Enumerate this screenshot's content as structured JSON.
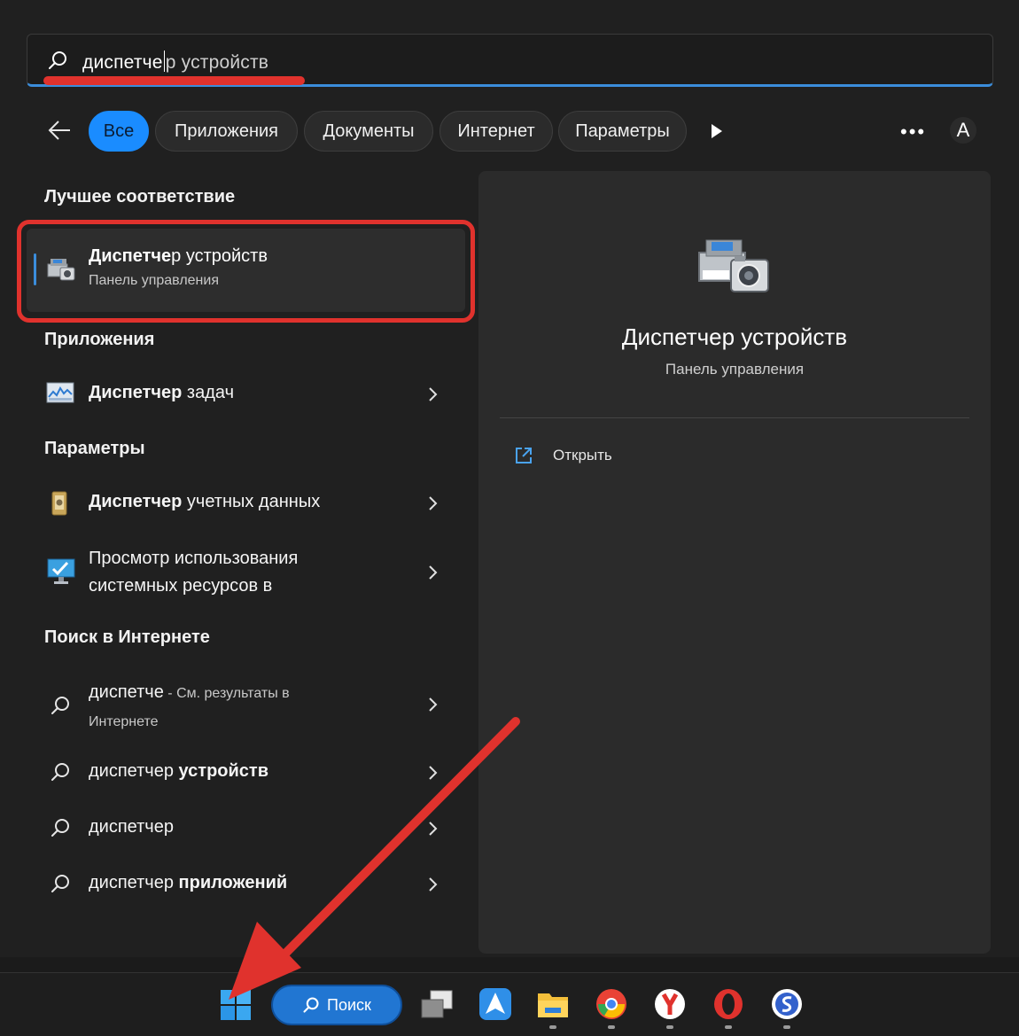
{
  "search": {
    "query_typed": "диспетче",
    "query_suggested": "р устройств"
  },
  "filters": {
    "items": [
      "Все",
      "Приложения",
      "Документы",
      "Интернет",
      "Параметры"
    ],
    "active_index": 0,
    "avatar_letter": "A",
    "more_label": "•••"
  },
  "sections": {
    "best_match": "Лучшее соответствие",
    "apps": "Приложения",
    "settings": "Параметры",
    "web": "Поиск в Интернете"
  },
  "best_match": {
    "title_bold": "Диспетче",
    "title_rest": "р устройств",
    "subtitle": "Панель управления"
  },
  "apps": [
    {
      "bold": "Диспетчер",
      "rest": " задач"
    }
  ],
  "settings": [
    {
      "bold": "Диспетчер",
      "rest": " учетных данных"
    },
    {
      "line1": "Просмотр использования",
      "line2": "системных ресурсов в"
    }
  ],
  "web": [
    {
      "query": "диспетче",
      "suffix": " - См. результаты в",
      "line2": "Интернете"
    },
    {
      "normal": "диспетчер",
      "bold": " устройств"
    },
    {
      "normal": "диспетчер",
      "bold": ""
    },
    {
      "normal": "диспетчер",
      "bold": " приложений"
    }
  ],
  "preview": {
    "title": "Диспетчер устройств",
    "subtitle": "Панель управления",
    "open_label": "Открыть"
  },
  "taskbar": {
    "search_label": "Поиск"
  },
  "colors": {
    "accent": "#1a8cff",
    "highlight_red": "#e0322d",
    "panel_bg": "#202020"
  }
}
